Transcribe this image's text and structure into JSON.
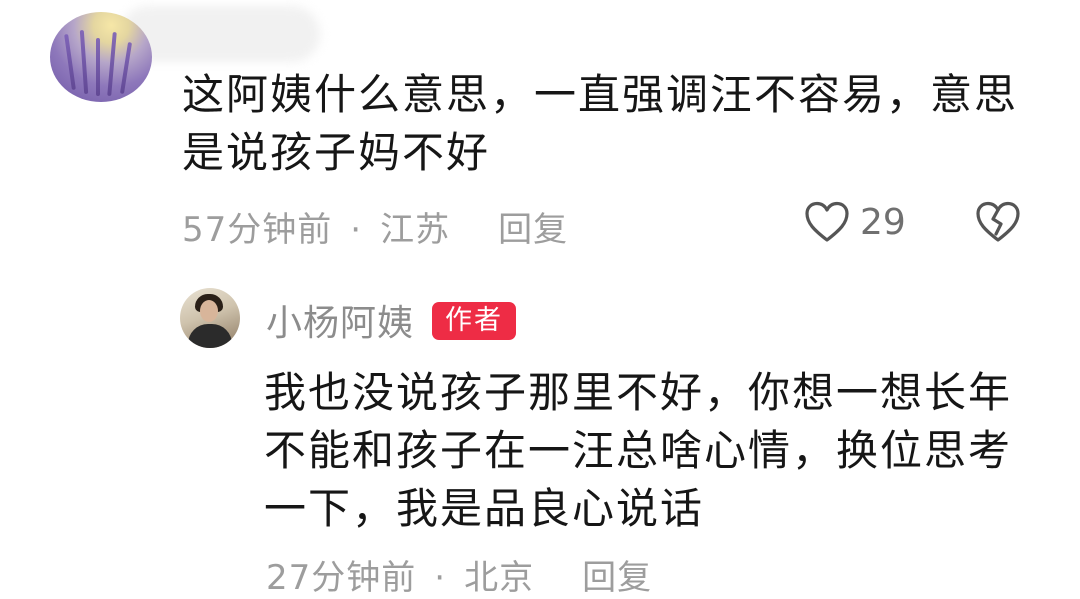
{
  "top_comment": {
    "text": "这阿姨什么意思，一直强调汪不容易，意思是说孩子妈不好",
    "time": "57分钟前",
    "separator": "·",
    "location": "江苏",
    "reply_label": "回复",
    "like_count": "29",
    "icons": [
      "heart-outline-icon",
      "broken-heart-icon"
    ]
  },
  "reply": {
    "author": "小杨阿姨",
    "badge": "作者",
    "text": "我也没说孩子那里不好，你想一想长年不能和孩子在一汪总啥心情，换位思考一下，我是品良心说话",
    "time": "27分钟前",
    "separator": "·",
    "location": "北京",
    "reply_label": "回复"
  },
  "colors": {
    "badge_bg": "#ee2c45",
    "meta_text": "#9d9d9d",
    "name_text": "#8c8c8c"
  }
}
